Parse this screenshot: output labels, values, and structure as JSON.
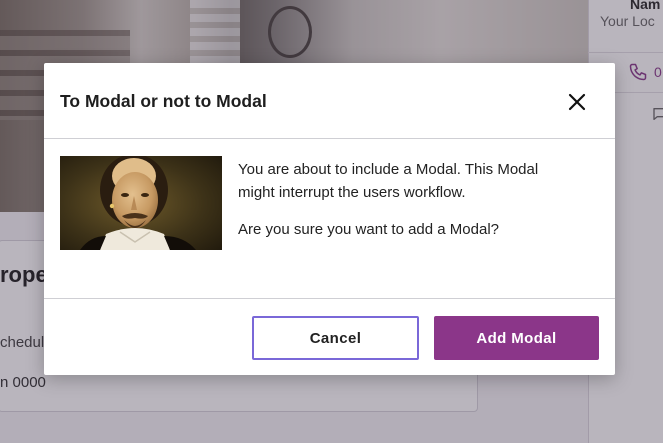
{
  "background": {
    "agent_name": "Nam",
    "agent_location": "Your Loc",
    "phone_prefix": "0",
    "detail_title": "rope",
    "detail_subtitle": "chedul",
    "detail_number": "n 0000"
  },
  "modal": {
    "title": "To Modal or not to Modal",
    "image_alt": "Portrait of William Shakespeare",
    "paragraph_1": "You are about to include a Modal. This Modal might interrupt the users workflow.",
    "paragraph_2": "Are you sure you want to add a Modal?",
    "cancel_label": "Cancel",
    "confirm_label": "Add Modal",
    "close_icon": "close-icon"
  },
  "colors": {
    "primary": "#8b3689",
    "cancel_border": "#7a68d8",
    "overlay": "rgba(50,38,62,0.34)"
  }
}
